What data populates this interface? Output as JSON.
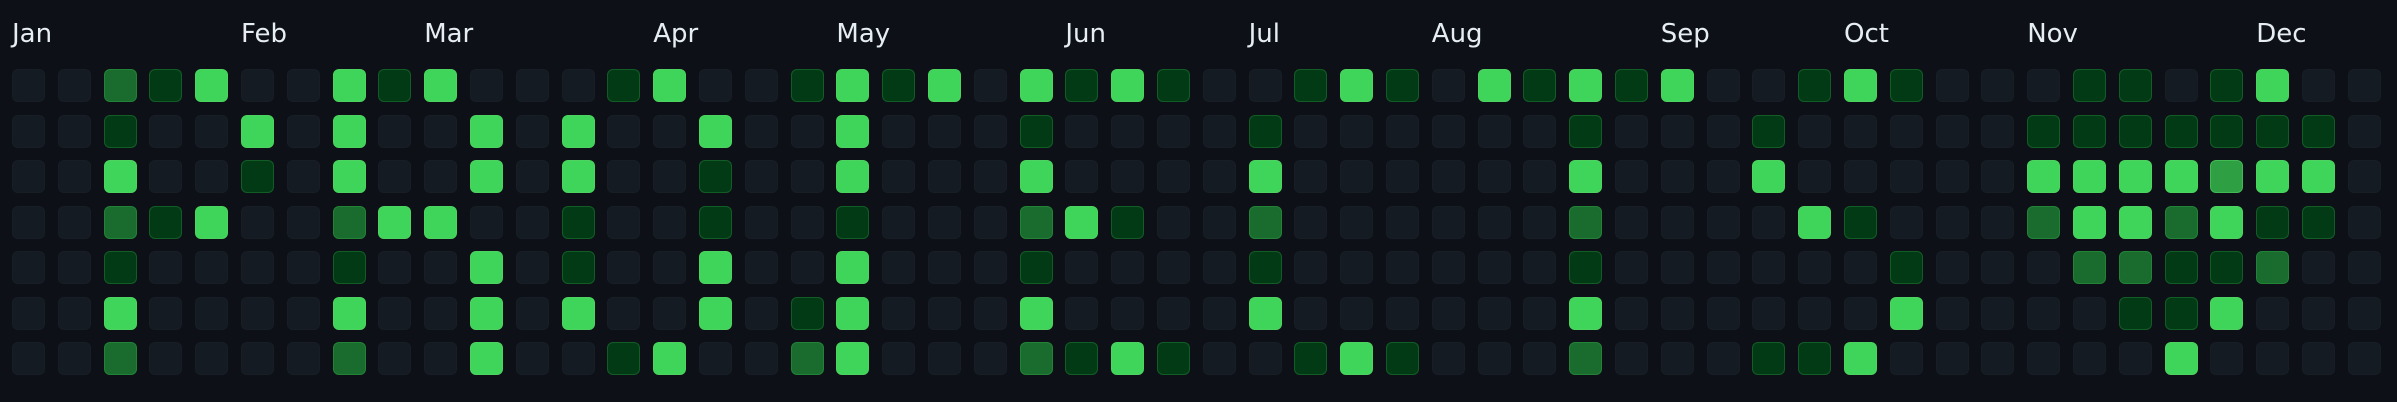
{
  "months": [
    {
      "label": "Jan",
      "week": 0
    },
    {
      "label": "Feb",
      "week": 5
    },
    {
      "label": "Mar",
      "week": 9
    },
    {
      "label": "Apr",
      "week": 14
    },
    {
      "label": "May",
      "week": 18
    },
    {
      "label": "Jun",
      "week": 23
    },
    {
      "label": "Jul",
      "week": 27
    },
    {
      "label": "Aug",
      "week": 31
    },
    {
      "label": "Sep",
      "week": 36
    },
    {
      "label": "Oct",
      "week": 40
    },
    {
      "label": "Nov",
      "week": 44
    },
    {
      "label": "Dec",
      "week": 49
    }
  ],
  "colors": {
    "background": "#0d1117",
    "level_0": "#151b23",
    "level_1": "#033a16",
    "level_2": "#196c2e",
    "level_3": "#2ea043",
    "level_4": "#3fd45a"
  },
  "contribution_levels": [
    [
      0,
      0,
      2,
      1,
      4,
      0,
      0,
      4,
      1,
      4,
      0,
      0,
      0,
      1,
      4,
      0,
      0,
      1,
      4,
      1,
      4,
      0,
      4,
      1,
      4,
      1,
      0,
      0,
      1,
      4,
      1,
      0,
      4,
      1,
      4,
      1,
      4,
      0,
      0,
      1,
      4,
      1,
      0,
      0,
      0,
      1,
      1,
      0,
      1,
      4,
      0,
      0
    ],
    [
      0,
      0,
      1,
      0,
      0,
      4,
      0,
      4,
      0,
      0,
      4,
      0,
      4,
      0,
      0,
      4,
      0,
      0,
      4,
      0,
      0,
      0,
      1,
      0,
      0,
      0,
      0,
      1,
      0,
      0,
      0,
      0,
      0,
      0,
      1,
      0,
      0,
      0,
      1,
      0,
      0,
      0,
      0,
      0,
      1,
      1,
      1,
      1,
      1,
      1,
      1,
      0
    ],
    [
      0,
      0,
      4,
      0,
      0,
      1,
      0,
      4,
      0,
      0,
      4,
      0,
      4,
      0,
      0,
      1,
      0,
      0,
      4,
      0,
      0,
      0,
      4,
      0,
      0,
      0,
      0,
      4,
      0,
      0,
      0,
      0,
      0,
      0,
      4,
      0,
      0,
      0,
      4,
      0,
      0,
      0,
      0,
      0,
      4,
      4,
      4,
      4,
      3,
      4,
      4,
      0
    ],
    [
      0,
      0,
      2,
      1,
      4,
      0,
      0,
      2,
      4,
      4,
      0,
      0,
      1,
      0,
      0,
      1,
      0,
      0,
      1,
      0,
      0,
      0,
      2,
      4,
      1,
      0,
      0,
      2,
      0,
      0,
      0,
      0,
      0,
      0,
      2,
      0,
      0,
      0,
      0,
      4,
      1,
      0,
      0,
      0,
      2,
      4,
      4,
      2,
      4,
      1,
      1,
      0
    ],
    [
      0,
      0,
      1,
      0,
      0,
      0,
      0,
      1,
      0,
      0,
      4,
      0,
      1,
      0,
      0,
      4,
      0,
      0,
      4,
      0,
      0,
      0,
      1,
      0,
      0,
      0,
      0,
      1,
      0,
      0,
      0,
      0,
      0,
      0,
      1,
      0,
      0,
      0,
      0,
      0,
      0,
      1,
      0,
      0,
      0,
      2,
      2,
      1,
      1,
      2,
      0,
      0
    ],
    [
      0,
      0,
      4,
      0,
      0,
      0,
      0,
      4,
      0,
      0,
      4,
      0,
      4,
      0,
      0,
      4,
      0,
      1,
      4,
      0,
      0,
      0,
      4,
      0,
      0,
      0,
      0,
      4,
      0,
      0,
      0,
      0,
      0,
      0,
      4,
      0,
      0,
      0,
      0,
      0,
      0,
      4,
      0,
      0,
      0,
      0,
      1,
      1,
      4,
      0,
      0,
      0
    ],
    [
      0,
      0,
      2,
      0,
      0,
      0,
      0,
      2,
      0,
      0,
      4,
      0,
      0,
      1,
      4,
      0,
      0,
      2,
      4,
      0,
      0,
      0,
      2,
      1,
      4,
      1,
      0,
      0,
      1,
      4,
      1,
      0,
      0,
      0,
      2,
      0,
      0,
      0,
      1,
      1,
      4,
      0,
      0,
      0,
      0,
      0,
      0,
      4,
      0,
      0,
      0,
      0
    ]
  ]
}
